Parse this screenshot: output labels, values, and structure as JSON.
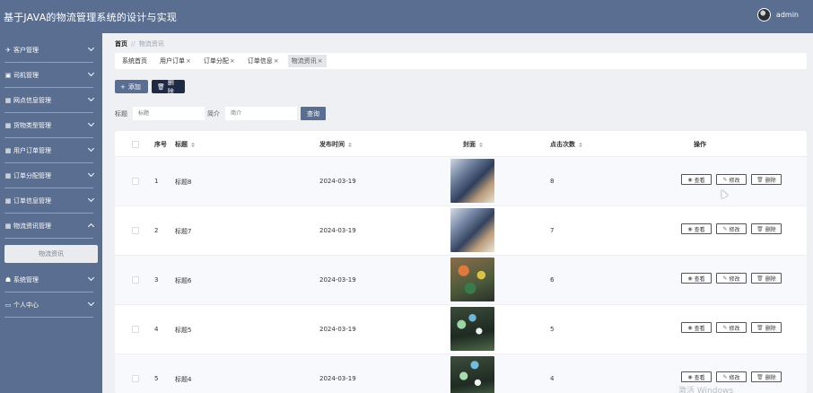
{
  "app": {
    "title": "基于JAVA的物流管理系统的设计与实现",
    "user": "admin"
  },
  "colors": {
    "primary": "#5a6e92",
    "dark_button": "#1f2a45",
    "background": "#eef0f4"
  },
  "sidebar": {
    "items": [
      {
        "label": "客户管理",
        "icon": "paper-plane-icon",
        "glyph": "✈",
        "expanded": false
      },
      {
        "label": "司机管理",
        "icon": "briefcase-icon",
        "glyph": "▣",
        "expanded": false
      },
      {
        "label": "网点信息管理",
        "icon": "grid-icon",
        "glyph": "▦",
        "expanded": false
      },
      {
        "label": "货物类型管理",
        "icon": "grid-icon",
        "glyph": "▦",
        "expanded": false
      },
      {
        "label": "用户订单管理",
        "icon": "grid-icon",
        "glyph": "▦",
        "expanded": false
      },
      {
        "label": "订单分配管理",
        "icon": "grid-icon",
        "glyph": "▦",
        "expanded": false
      },
      {
        "label": "订单信息管理",
        "icon": "grid-icon",
        "glyph": "▦",
        "expanded": false
      },
      {
        "label": "物流资讯管理",
        "icon": "grid-icon",
        "glyph": "▦",
        "expanded": true
      },
      {
        "label": "系统管理",
        "icon": "thumbs-up-icon",
        "glyph": "☗",
        "expanded": false
      },
      {
        "label": "个人中心",
        "icon": "id-card-icon",
        "glyph": "▭",
        "expanded": false
      }
    ],
    "sub_item": "物流资讯"
  },
  "breadcrumb": {
    "home": "首页",
    "separator": "//",
    "current": "物流资讯"
  },
  "tabs": [
    {
      "label": "系统首页",
      "closable": false,
      "active": false
    },
    {
      "label": "用户订单",
      "closable": true,
      "active": false
    },
    {
      "label": "订单分配",
      "closable": true,
      "active": false
    },
    {
      "label": "订单信息",
      "closable": true,
      "active": false
    },
    {
      "label": "物流资讯",
      "closable": true,
      "active": true
    }
  ],
  "toolbar": {
    "add_label": "添加",
    "delete_label": "删除"
  },
  "search": {
    "title_label": "标题",
    "title_placeholder": "标题",
    "intro_label": "简介",
    "intro_placeholder": "简介",
    "button_label": "查询"
  },
  "table": {
    "headers": {
      "index": "序号",
      "title": "标题",
      "publish_time": "发布时间",
      "cover": "封面",
      "clicks": "点击次数",
      "actions": "操作"
    },
    "rows": [
      {
        "index": "1",
        "title": "标题8",
        "publish_time": "2024-03-19",
        "clicks": "8"
      },
      {
        "index": "2",
        "title": "标题7",
        "publish_time": "2024-03-19",
        "clicks": "7"
      },
      {
        "index": "3",
        "title": "标题6",
        "publish_time": "2024-03-19",
        "clicks": "6"
      },
      {
        "index": "4",
        "title": "标题5",
        "publish_time": "2024-03-19",
        "clicks": "5"
      },
      {
        "index": "5",
        "title": "标题4",
        "publish_time": "2024-03-19",
        "clicks": "4"
      }
    ],
    "action_labels": {
      "view": "查看",
      "edit": "修改",
      "delete": "删除"
    }
  },
  "watermark": "激活 Windows"
}
